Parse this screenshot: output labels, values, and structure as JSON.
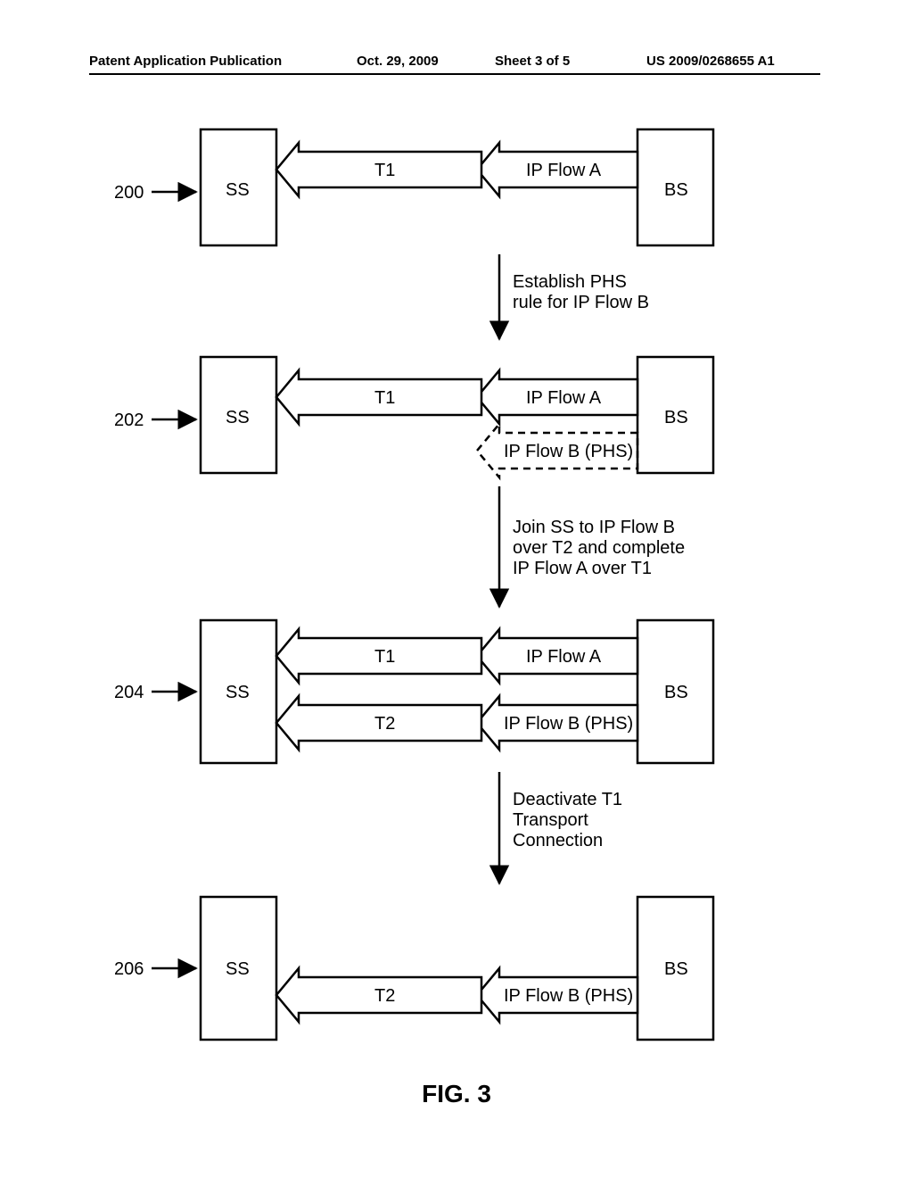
{
  "header": {
    "publication": "Patent Application Publication",
    "date": "Oct. 29, 2009",
    "sheet": "Sheet 3 of 5",
    "number": "US 2009/0268655 A1"
  },
  "figure": {
    "caption": "FIG. 3",
    "refs": {
      "r200": "200",
      "r202": "202",
      "r204": "204",
      "r206": "206"
    },
    "nodes": {
      "ss": "SS",
      "bs": "BS"
    },
    "flows": {
      "t1": "T1",
      "t2": "T2",
      "flowA": "IP Flow A",
      "flowB_phs": "IP Flow B (PHS)"
    },
    "steps": {
      "s1": "Establish PHS\nrule for IP Flow B",
      "s2": "Join SS to IP Flow B\nover T2 and complete\nIP Flow A over T1",
      "s3": "Deactivate T1\nTransport\nConnection"
    }
  }
}
